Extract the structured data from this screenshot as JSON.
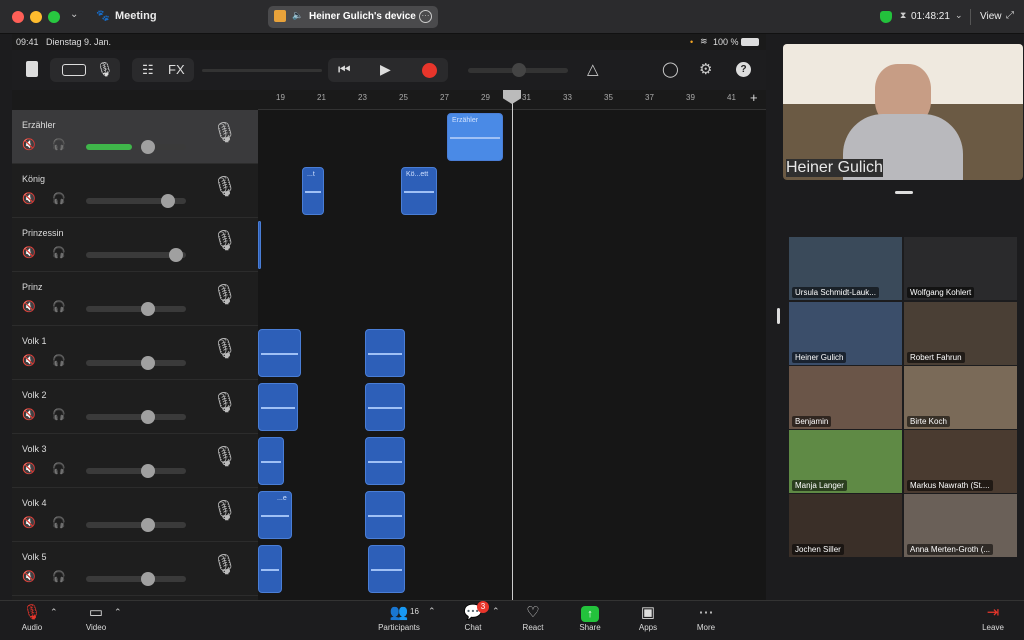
{
  "window": {
    "title": "Meeting",
    "share_label": "Heiner Gulich's device",
    "timer": "01:48:21",
    "view_label": "View"
  },
  "ipad": {
    "time": "09:41",
    "date": "Dienstag 9. Jan.",
    "battery": "100 %",
    "fx_label": "FX"
  },
  "ruler": [
    "19",
    "21",
    "23",
    "25",
    "27",
    "29",
    "31",
    "33",
    "35",
    "37",
    "39",
    "41"
  ],
  "tracks": [
    {
      "name": "Erzähler",
      "volume": 0.62
    },
    {
      "name": "König",
      "volume": 0.82
    },
    {
      "name": "Prinzessin",
      "volume": 0.9
    },
    {
      "name": "Prinz",
      "volume": 0.62
    },
    {
      "name": "Volk 1",
      "volume": 0.62
    },
    {
      "name": "Volk 2",
      "volume": 0.62
    },
    {
      "name": "Volk 3",
      "volume": 0.62
    },
    {
      "name": "Volk 4",
      "volume": 0.62
    },
    {
      "name": "Volk 5",
      "volume": 0.62
    }
  ],
  "regions": {
    "erzaehler": "Erzähler",
    "koenig1": "...t",
    "koenig2": "Kö...ett",
    "volk4a": "...e"
  },
  "video": {
    "main": "Heiner Gulich"
  },
  "gallery": [
    "Ursula Schmidt-Lauk...",
    "Wolfgang Kohlert",
    "Heiner Gulich",
    "Robert Fahrun",
    "Benjamin",
    "Birte Koch",
    "Manja Langer",
    "Markus Nawrath (St....",
    "Jochen Siller",
    "Anna Merten-Groth (..."
  ],
  "controls": {
    "audio": "Audio",
    "video": "Video",
    "participants": "Participants",
    "participants_count": "16",
    "chat": "Chat",
    "chat_badge": "3",
    "react": "React",
    "share": "Share",
    "apps": "Apps",
    "more": "More",
    "leave": "Leave"
  },
  "colors": {
    "share_green": "#23c23c",
    "record_red": "#e8352b",
    "region_blue": "#2d5fb8",
    "leave_red": "#e8352b"
  }
}
